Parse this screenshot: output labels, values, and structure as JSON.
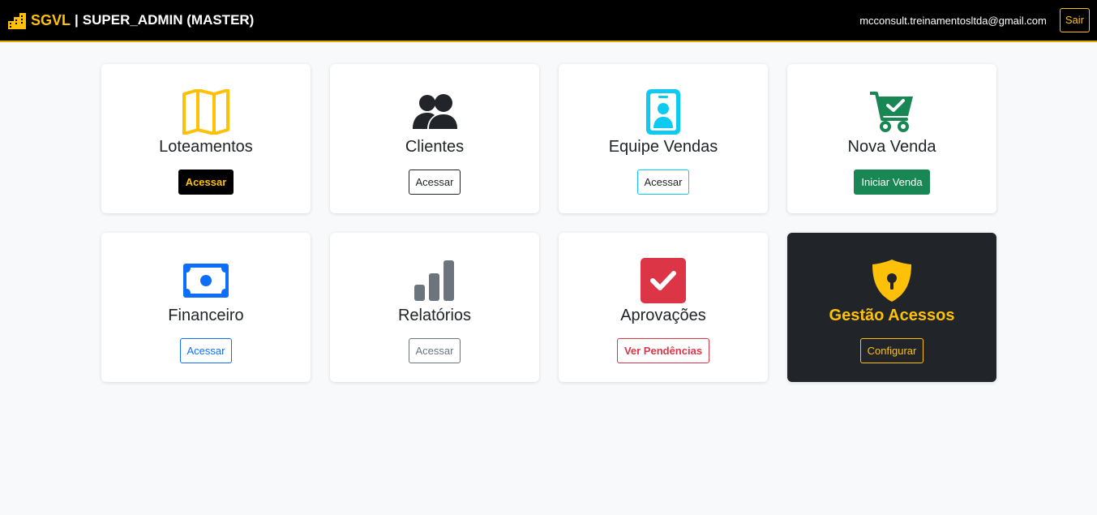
{
  "header": {
    "brand_name": "SGVL",
    "separator": "|",
    "role": "SUPER_ADMIN (MASTER)",
    "user_email": "mcconsult.treinamentosltda@gmail.com",
    "logout_label": "Sair",
    "brand_icon": "buildings-icon",
    "accent_color": "#ffc107"
  },
  "cards": [
    {
      "title": "Loteamentos",
      "button": "Acessar",
      "icon": "map-icon",
      "icon_color": "#ffc107"
    },
    {
      "title": "Clientes",
      "button": "Acessar",
      "icon": "people-icon",
      "icon_color": "#212529"
    },
    {
      "title": "Equipe Vendas",
      "button": "Acessar",
      "icon": "badge-icon",
      "icon_color": "#0dcaf0"
    },
    {
      "title": "Nova Venda",
      "button": "Iniciar Venda",
      "icon": "cart-check-icon",
      "icon_color": "#198754"
    },
    {
      "title": "Financeiro",
      "button": "Acessar",
      "icon": "cash-icon",
      "icon_color": "#0d6efd"
    },
    {
      "title": "Relatórios",
      "button": "Acessar",
      "icon": "bar-chart-icon",
      "icon_color": "#6c757d"
    },
    {
      "title": "Aprovações",
      "button": "Ver Pendências",
      "icon": "check-square-icon",
      "icon_color": "#dc3545"
    },
    {
      "title": "Gestão Acessos",
      "button": "Configurar",
      "icon": "shield-lock-icon",
      "icon_color": "#ffc107"
    }
  ]
}
